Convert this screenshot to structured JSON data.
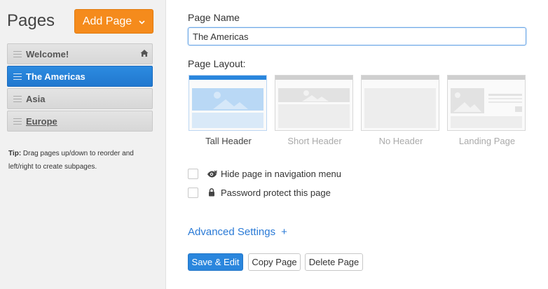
{
  "sidebar": {
    "title": "Pages",
    "add_button": "Add Page",
    "pages": [
      {
        "label": "Welcome!",
        "home": true
      },
      {
        "label": "The Americas"
      },
      {
        "label": "Asia"
      },
      {
        "label": "Europe"
      }
    ],
    "tip_label": "Tip:",
    "tip_text": " Drag pages up/down to reorder and left/right to create subpages."
  },
  "form": {
    "name_label": "Page Name",
    "name_value": "The Americas",
    "layout_label": "Page Layout:",
    "layouts": [
      {
        "label": "Tall Header",
        "selected": true
      },
      {
        "label": "Short Header"
      },
      {
        "label": "No Header"
      },
      {
        "label": "Landing Page"
      }
    ],
    "option_hide": "Hide page in navigation menu",
    "option_password": "Password protect this page",
    "advanced_label": "Advanced Settings",
    "advanced_plus": "+"
  },
  "actions": {
    "save": "Save & Edit",
    "copy": "Copy Page",
    "delete": "Delete Page"
  },
  "colors": {
    "accent": "#2a86dd",
    "add_button": "#f58b1c",
    "link": "#2a7ad6"
  }
}
